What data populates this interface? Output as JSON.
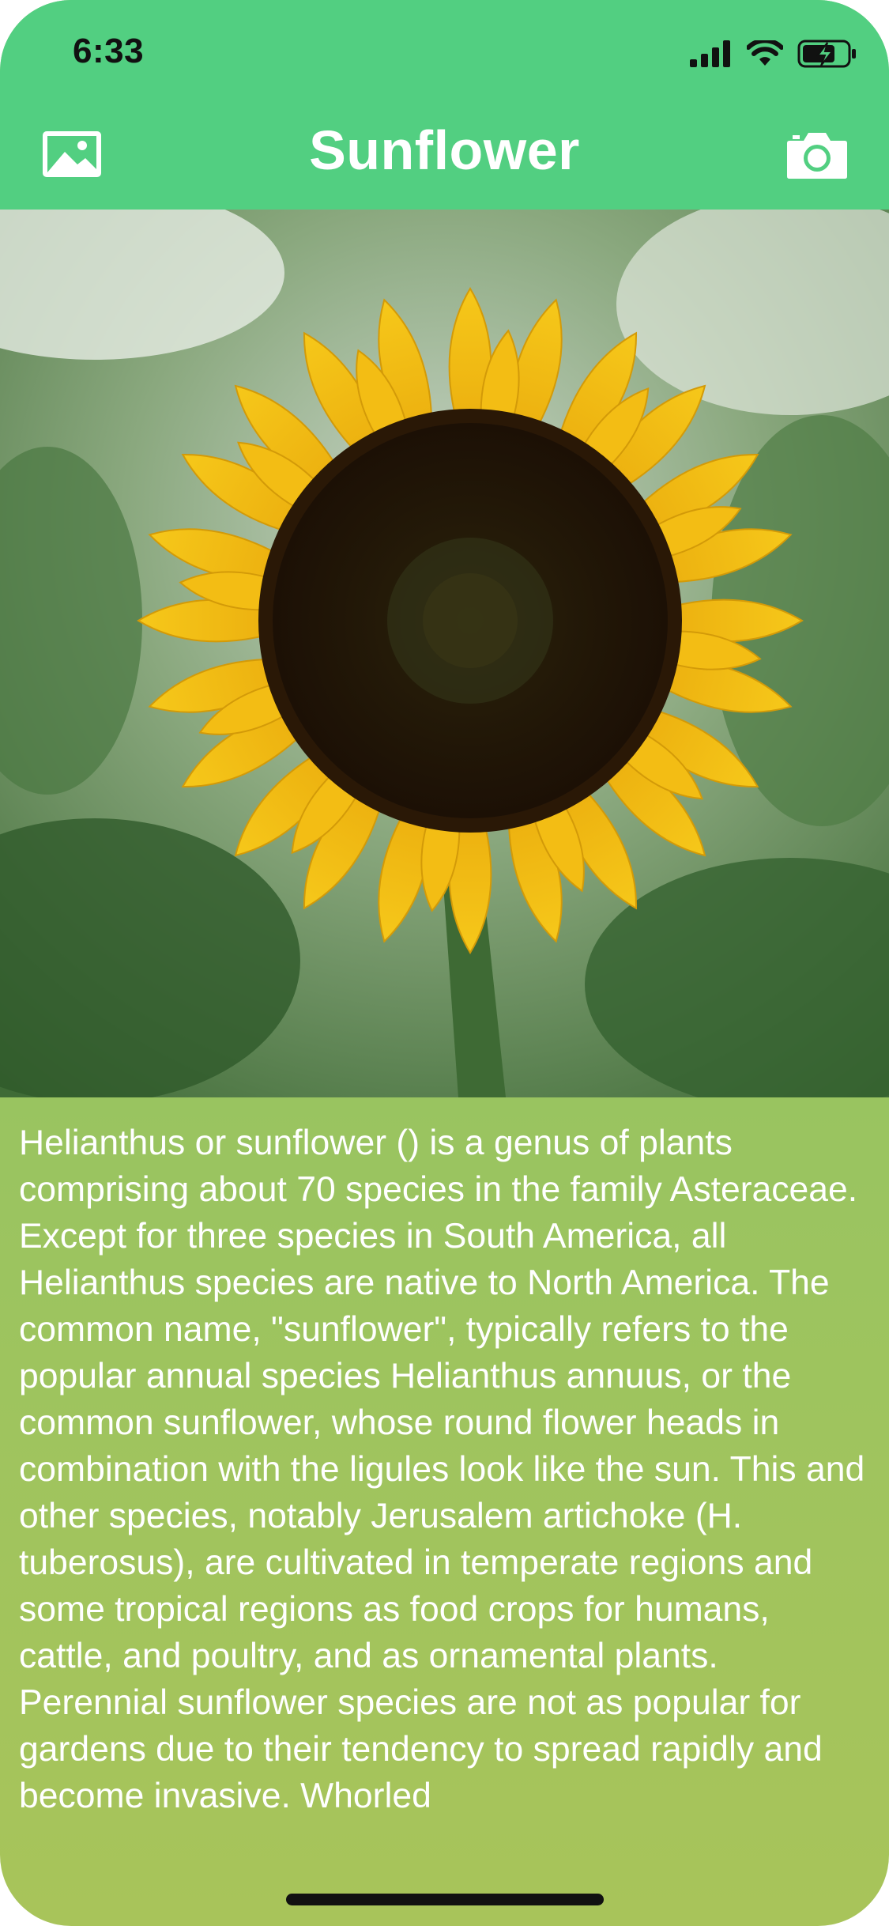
{
  "status_bar": {
    "time": "6:33"
  },
  "header": {
    "title": "Sunflower",
    "left_icon": "photo-library-icon",
    "right_icon": "camera-icon",
    "background_color": "#52cf81"
  },
  "content": {
    "paragraphs": [
      "Helianthus or sunflower () is a genus of plants comprising about 70 species in the family Asteraceae. Except for three species in South America, all Helianthus species are native to North America. The common name, \"sunflower\", typically refers to the popular annual species Helianthus annuus, or the common sunflower, whose round flower heads in combination with the ligules look like the sun. This and other species, notably Jerusalem artichoke (H. tuberosus), are cultivated in temperate regions and some tropical regions as food crops for humans, cattle, and poultry, and as ornamental plants.",
      "Perennial sunflower species are not as popular for gardens due to their tendency to spread rapidly and become invasive. Whorled"
    ]
  }
}
